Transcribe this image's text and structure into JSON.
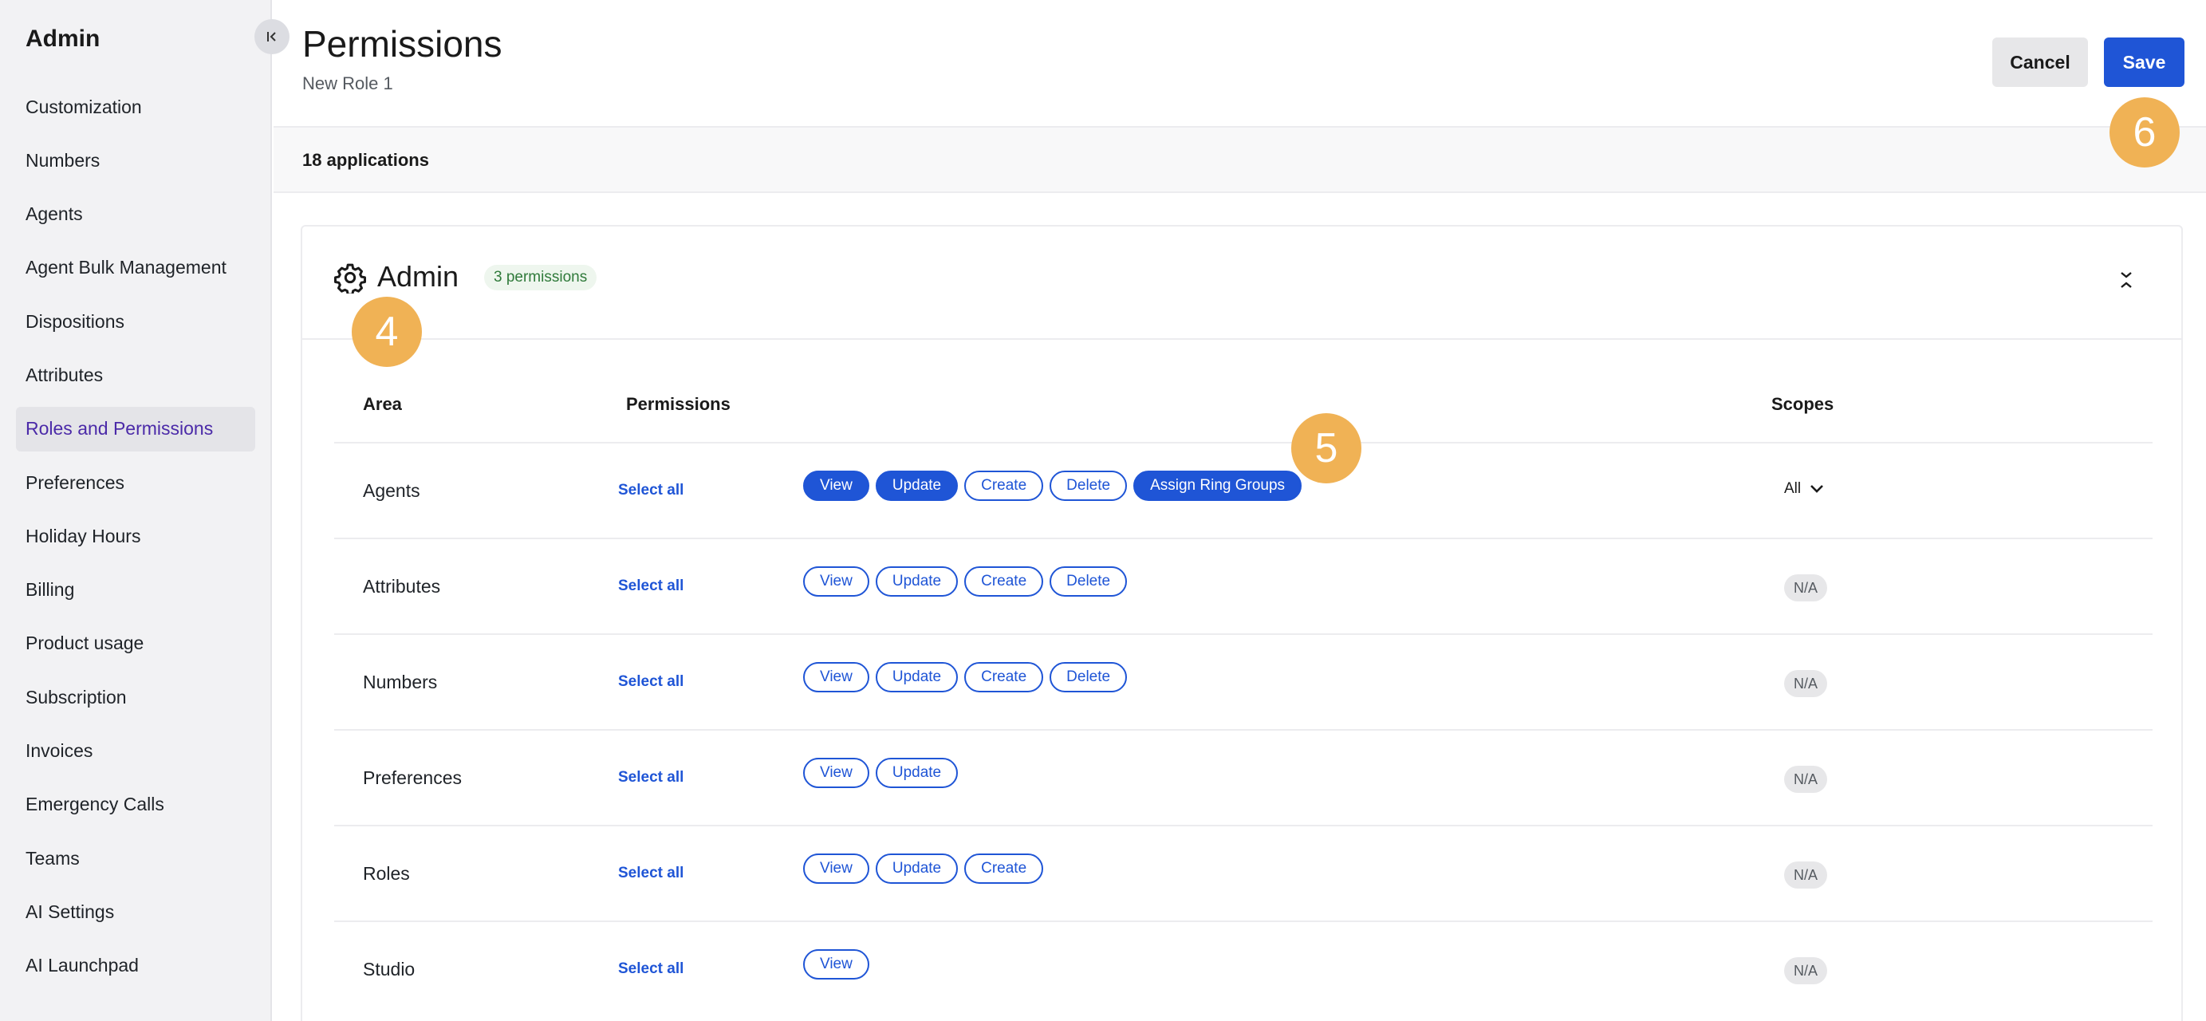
{
  "sidebar": {
    "title": "Admin",
    "items": [
      {
        "label": "Customization",
        "active": false
      },
      {
        "label": "Numbers",
        "active": false
      },
      {
        "label": "Agents",
        "active": false
      },
      {
        "label": "Agent Bulk Management",
        "active": false
      },
      {
        "label": "Dispositions",
        "active": false
      },
      {
        "label": "Attributes",
        "active": false
      },
      {
        "label": "Roles and Permissions",
        "active": true
      },
      {
        "label": "Preferences",
        "active": false
      },
      {
        "label": "Holiday Hours",
        "active": false
      },
      {
        "label": "Billing",
        "active": false
      },
      {
        "label": "Product usage",
        "active": false
      },
      {
        "label": "Subscription",
        "active": false
      },
      {
        "label": "Invoices",
        "active": false
      },
      {
        "label": "Emergency Calls",
        "active": false
      },
      {
        "label": "Teams",
        "active": false
      },
      {
        "label": "AI Settings",
        "active": false
      },
      {
        "label": "AI Launchpad",
        "active": false
      }
    ]
  },
  "header": {
    "title": "Permissions",
    "subtitle": "New Role 1",
    "cancel_label": "Cancel",
    "save_label": "Save"
  },
  "apps_count": "18 applications",
  "card": {
    "title": "Admin",
    "badge": "3 permissions",
    "columns": {
      "area": "Area",
      "permissions": "Permissions",
      "scopes": "Scopes"
    },
    "select_all_label": "Select all",
    "rows": [
      {
        "area": "Agents",
        "permissions": [
          {
            "label": "View",
            "selected": true
          },
          {
            "label": "Update",
            "selected": true
          },
          {
            "label": "Create",
            "selected": false
          },
          {
            "label": "Delete",
            "selected": false
          },
          {
            "label": "Assign Ring Groups",
            "selected": true
          }
        ],
        "scope": "All",
        "scope_type": "dropdown"
      },
      {
        "area": "Attributes",
        "permissions": [
          {
            "label": "View",
            "selected": false
          },
          {
            "label": "Update",
            "selected": false
          },
          {
            "label": "Create",
            "selected": false
          },
          {
            "label": "Delete",
            "selected": false
          }
        ],
        "scope": "N/A",
        "scope_type": "badge"
      },
      {
        "area": "Numbers",
        "permissions": [
          {
            "label": "View",
            "selected": false
          },
          {
            "label": "Update",
            "selected": false
          },
          {
            "label": "Create",
            "selected": false
          },
          {
            "label": "Delete",
            "selected": false
          }
        ],
        "scope": "N/A",
        "scope_type": "badge"
      },
      {
        "area": "Preferences",
        "permissions": [
          {
            "label": "View",
            "selected": false
          },
          {
            "label": "Update",
            "selected": false
          }
        ],
        "scope": "N/A",
        "scope_type": "badge"
      },
      {
        "area": "Roles",
        "permissions": [
          {
            "label": "View",
            "selected": false
          },
          {
            "label": "Update",
            "selected": false
          },
          {
            "label": "Create",
            "selected": false
          }
        ],
        "scope": "N/A",
        "scope_type": "badge"
      },
      {
        "area": "Studio",
        "permissions": [
          {
            "label": "View",
            "selected": false
          }
        ],
        "scope": "N/A",
        "scope_type": "badge"
      }
    ]
  },
  "markers": [
    {
      "label": "4"
    },
    {
      "label": "5"
    },
    {
      "label": "6"
    }
  ],
  "colors": {
    "accent": "#1f55d6",
    "active_nav_text": "#4b2aa8",
    "marker": "#f0b255",
    "badge_text": "#2f7a3a"
  }
}
